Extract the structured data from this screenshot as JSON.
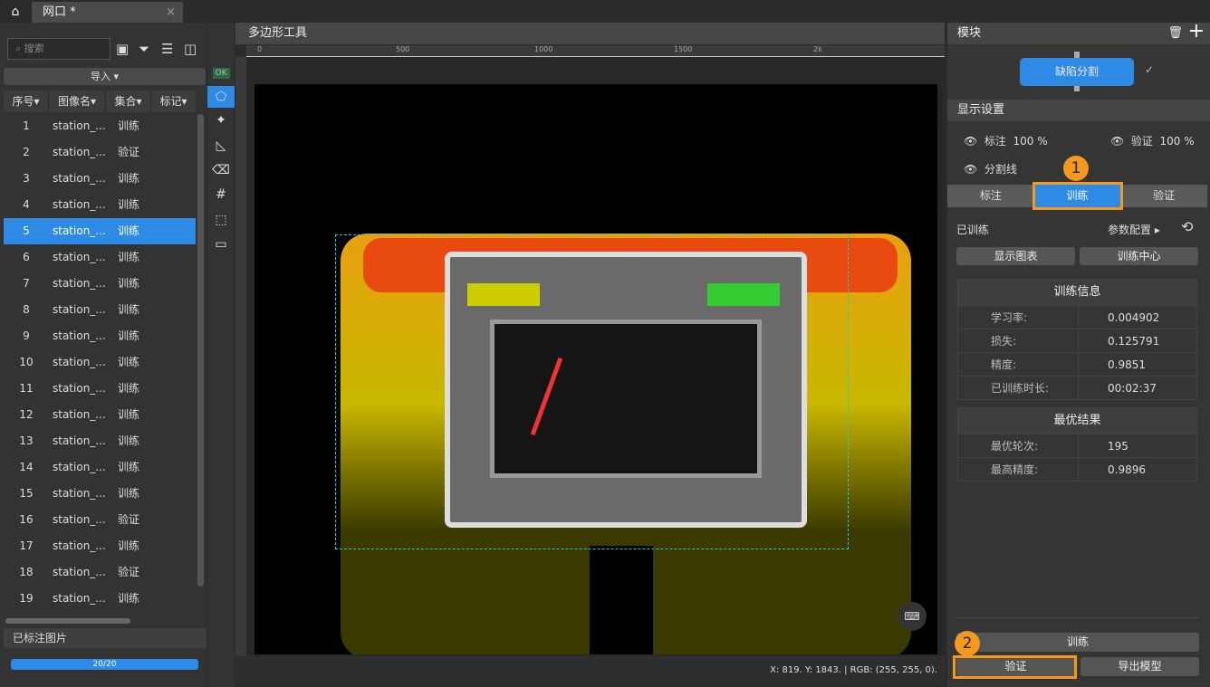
{
  "tabbar": {
    "tab_title": "网口 *",
    "close": "×"
  },
  "left": {
    "search_placeholder": "搜索",
    "import_label": "导入",
    "columns": [
      "序号",
      "图像名",
      "集合",
      "标记"
    ],
    "rows": [
      [
        "1",
        "station_...",
        "训练"
      ],
      [
        "2",
        "station_...",
        "验证"
      ],
      [
        "3",
        "station_...",
        "训练"
      ],
      [
        "4",
        "station_...",
        "训练"
      ],
      [
        "5",
        "station_...",
        "训练"
      ],
      [
        "6",
        "station_...",
        "训练"
      ],
      [
        "7",
        "station_...",
        "训练"
      ],
      [
        "8",
        "station_...",
        "训练"
      ],
      [
        "9",
        "station_...",
        "训练"
      ],
      [
        "10",
        "station_...",
        "训练"
      ],
      [
        "11",
        "station_...",
        "训练"
      ],
      [
        "12",
        "station_...",
        "训练"
      ],
      [
        "13",
        "station_...",
        "训练"
      ],
      [
        "14",
        "station_...",
        "训练"
      ],
      [
        "15",
        "station_...",
        "训练"
      ],
      [
        "16",
        "station_...",
        "验证"
      ],
      [
        "17",
        "station_...",
        "训练"
      ],
      [
        "18",
        "station_...",
        "验证"
      ],
      [
        "19",
        "station_...",
        "训练"
      ]
    ],
    "selected_row": 5,
    "labeled_title": "已标注图片",
    "progress_text": "20/20",
    "progress": 1.0
  },
  "tools": {
    "ok": "OK"
  },
  "canvas": {
    "title": "多边形工具",
    "ruler_ticks": [
      "0",
      "500",
      "1000",
      "1500",
      "2k"
    ],
    "status": "X: 819. Y: 1843. | RGB: (255, 255, 0)."
  },
  "right": {
    "module_title": "模块",
    "module_name": "缺陷分割",
    "display_title": "显示设置",
    "annot_label": "标注",
    "annot_pct": "100 %",
    "verify_label": "验证",
    "verify_pct": "100 %",
    "seg_line": "分割线",
    "tabs": [
      "标注",
      "训练",
      "验证"
    ],
    "trained": "已训练",
    "params": "参数配置",
    "show_chart": "显示图表",
    "train_center": "训练中心",
    "info_title": "训练信息",
    "info": [
      [
        "学习率:",
        "0.004902"
      ],
      [
        "损失:",
        "0.125791"
      ],
      [
        "精度:",
        "0.9851"
      ],
      [
        "已训练时长:",
        "00:02:37"
      ]
    ],
    "best_title": "最优结果",
    "best": [
      [
        "最优轮次:",
        "195"
      ],
      [
        "最高精度:",
        "0.9896"
      ]
    ],
    "train_btn": "训练",
    "verify_btn": "验证",
    "export_btn": "导出模型"
  },
  "annotations": {
    "step1": "1",
    "step2": "2"
  },
  "colors": {
    "accent": "#2d8ae5",
    "highlight": "#f39a1e"
  }
}
